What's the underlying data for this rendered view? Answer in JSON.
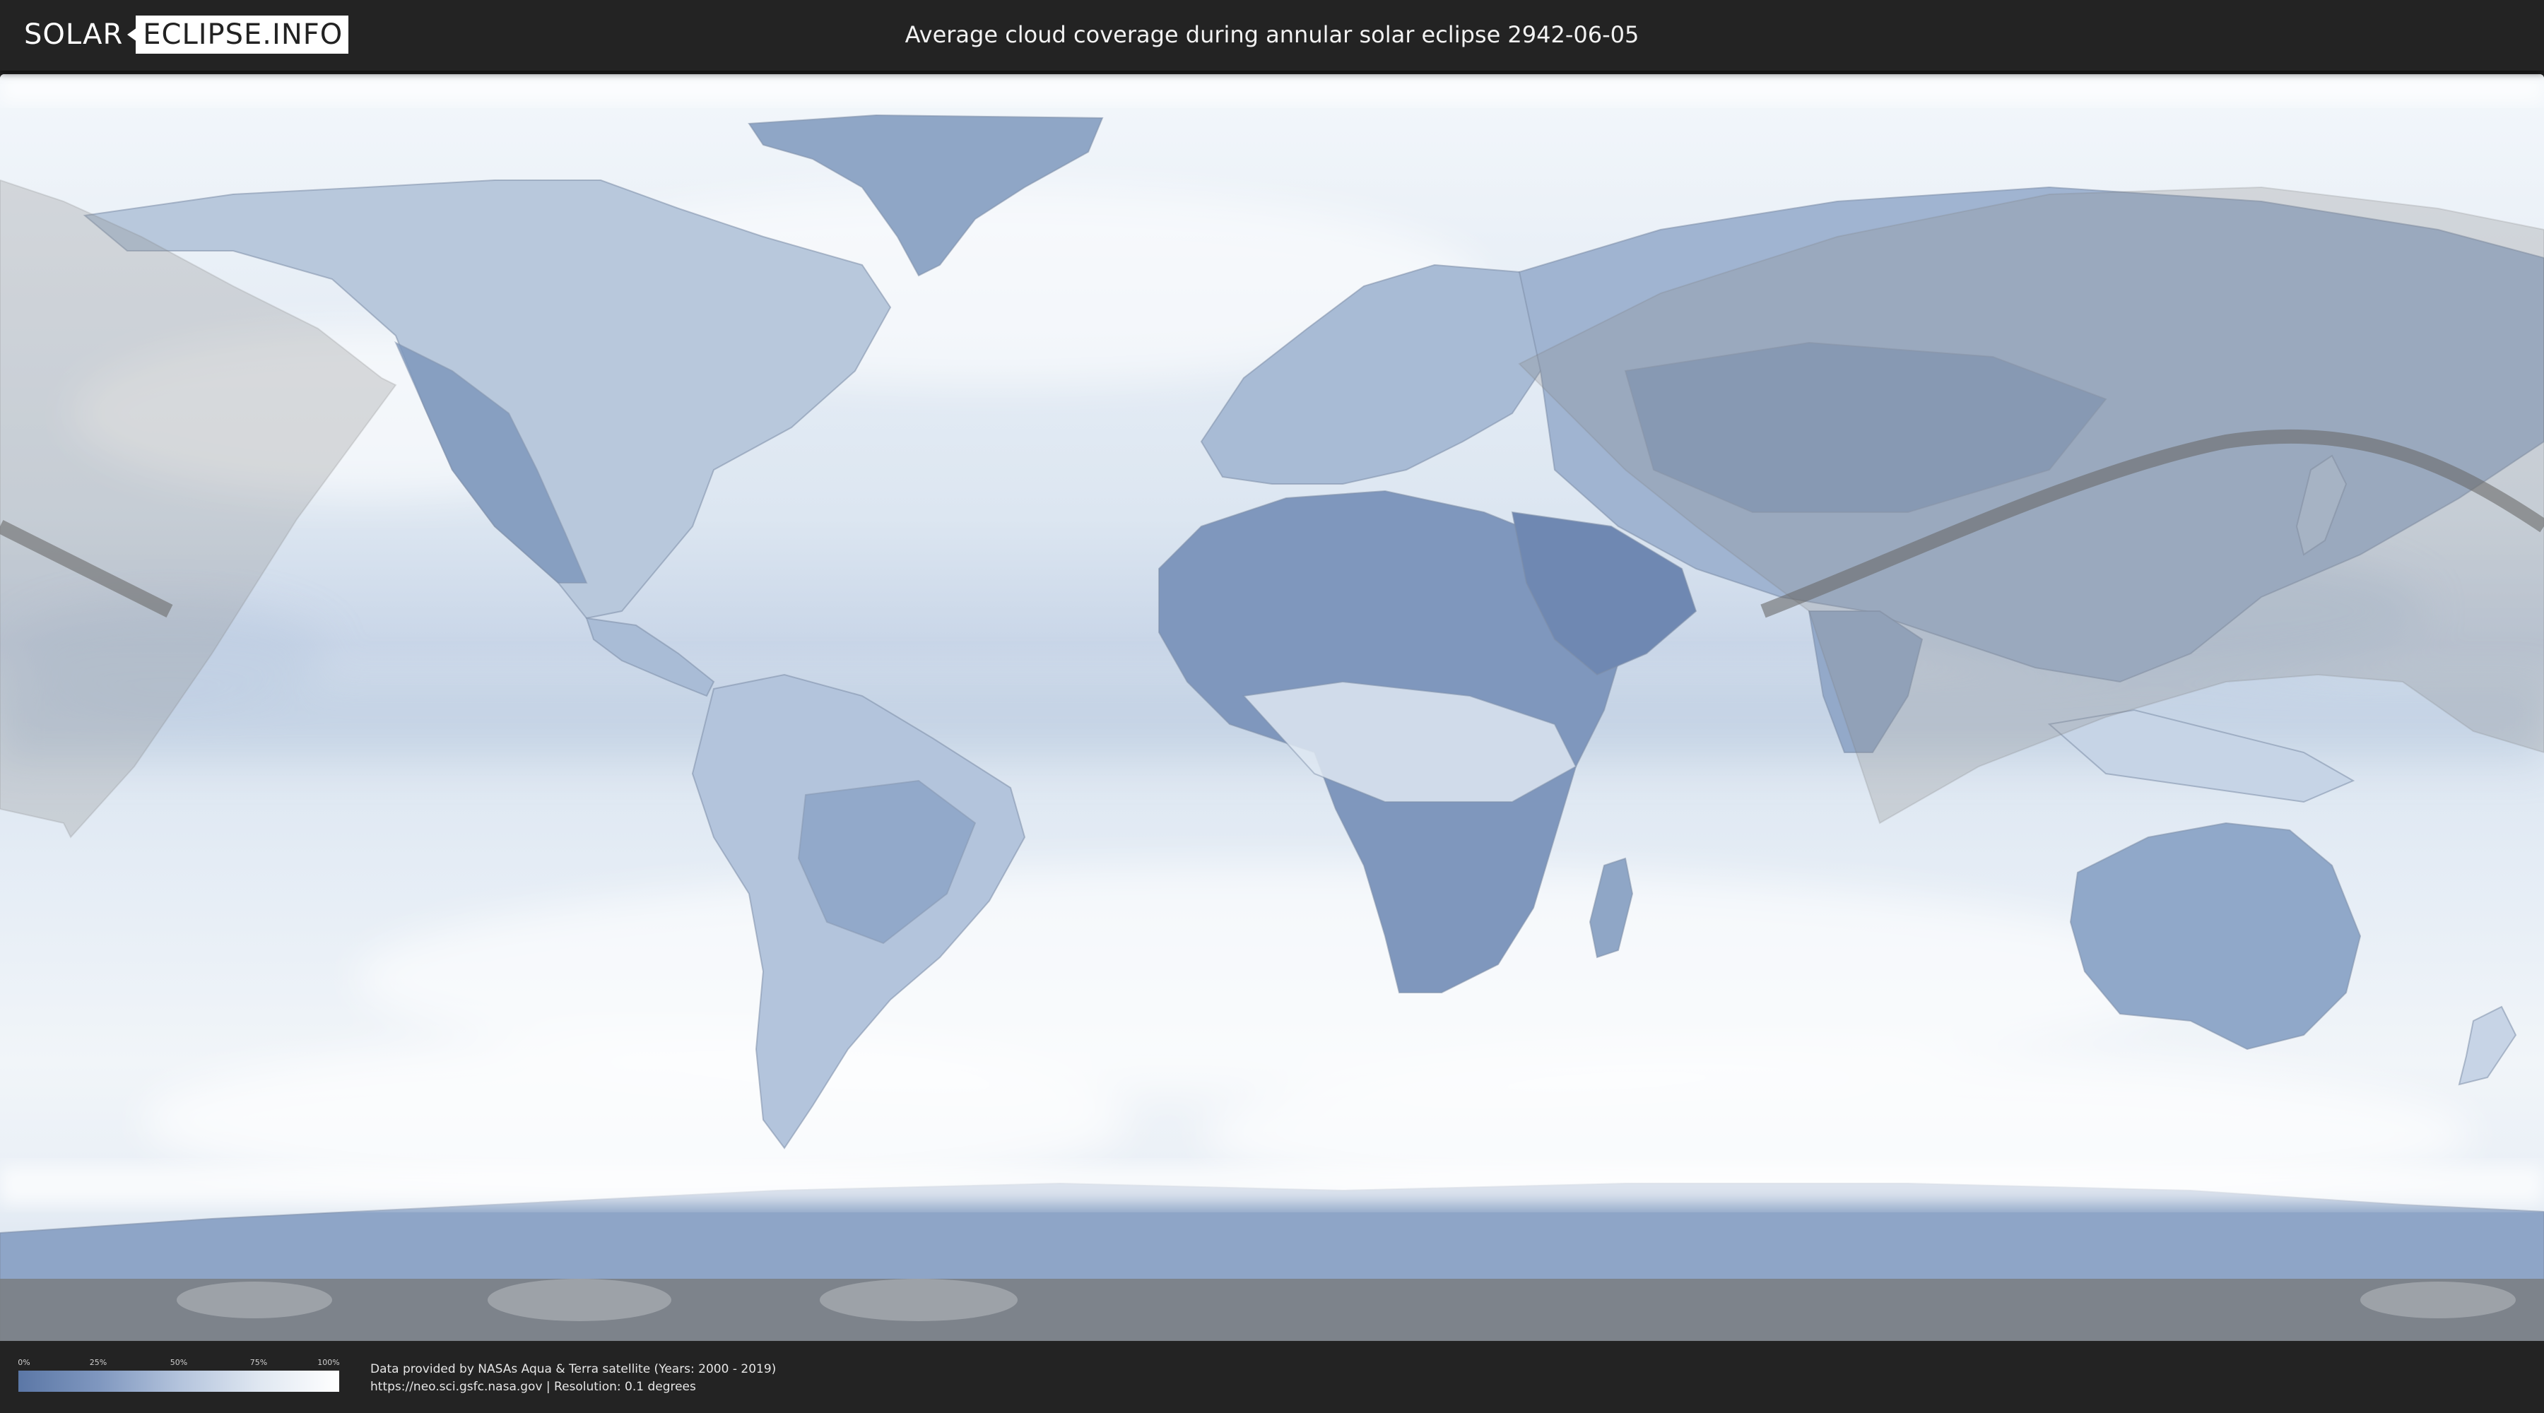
{
  "header": {
    "logo_part1": "SOLAR",
    "logo_part2": "ECLIPSE.INFO",
    "title": "Average cloud coverage during annular solar eclipse 2942-06-05"
  },
  "map": {
    "type": "world cloud coverage map",
    "projection": "equirectangular",
    "overlay": "annular solar eclipse visibility zone and central path",
    "colors": {
      "clear_sky": "#5b77a6",
      "overcast": "#ffffff",
      "eclipse_zone": "#9a9a9a",
      "central_path": "#6e6e6e"
    }
  },
  "legend": {
    "ticks": [
      "0%",
      "25%",
      "50%",
      "75%",
      "100%"
    ],
    "tick_fractions": [
      0,
      0.25,
      0.5,
      0.75,
      1.0
    ]
  },
  "footer": {
    "credit_line1": "Data provided by NASAs Aqua & Terra satellite (Years: 2000 - 2019)",
    "credit_line2": "https://neo.sci.gsfc.nasa.gov | Resolution: 0.1 degrees"
  }
}
